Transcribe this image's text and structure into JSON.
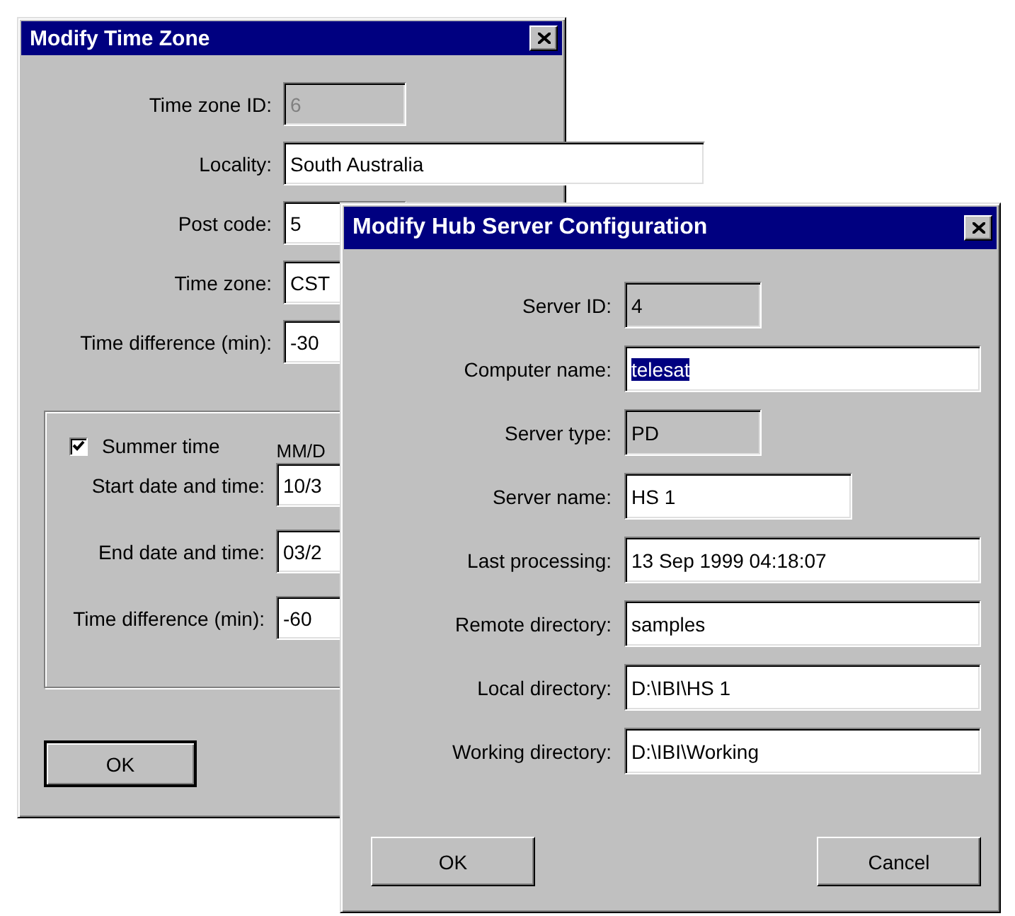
{
  "windows": [
    {
      "title": "Modify Time Zone",
      "fields": [
        {
          "label": "Time zone ID:",
          "value": "6",
          "disabled": true,
          "read_only": false,
          "highlighted": false
        },
        {
          "label": "Locality:",
          "value": "South Australia",
          "disabled": false,
          "read_only": false,
          "highlighted": false
        },
        {
          "label": "Post code:",
          "value": "5",
          "disabled": false,
          "read_only": false,
          "highlighted": false
        },
        {
          "label": "Time zone:",
          "value": "CST",
          "disabled": false,
          "read_only": false,
          "highlighted": false
        },
        {
          "label": "Time difference (min):",
          "value": "-30",
          "disabled": false,
          "read_only": false,
          "highlighted": false
        }
      ],
      "group": {
        "checkbox": {
          "label": "Summer time",
          "checked": true
        },
        "column_header": "MM/D",
        "fields": [
          {
            "label": "Start date and time:",
            "value": "10/3",
            "disabled": false,
            "read_only": false,
            "highlighted": false
          },
          {
            "label": "End date and time:",
            "value": "03/2",
            "disabled": false,
            "read_only": false,
            "highlighted": false
          },
          {
            "label": "Time difference (min):",
            "value": "-60",
            "disabled": false,
            "read_only": false,
            "highlighted": false
          }
        ]
      },
      "buttons": [
        "OK"
      ]
    },
    {
      "title": "Modify Hub Server Configuration",
      "fields": [
        {
          "label": "Server ID:",
          "value": "4",
          "disabled": false,
          "read_only": true,
          "highlighted": false
        },
        {
          "label": "Computer name:",
          "value": "telesat",
          "disabled": false,
          "read_only": false,
          "highlighted": true
        },
        {
          "label": "Server type:",
          "value": "PD",
          "disabled": false,
          "read_only": true,
          "highlighted": false
        },
        {
          "label": "Server name:",
          "value": "HS 1",
          "disabled": false,
          "read_only": false,
          "highlighted": false
        },
        {
          "label": "Last processing:",
          "value": "13 Sep 1999 04:18:07",
          "disabled": false,
          "read_only": false,
          "highlighted": false
        },
        {
          "label": "Remote directory:",
          "value": "samples",
          "disabled": false,
          "read_only": false,
          "highlighted": false
        },
        {
          "label": "Local directory:",
          "value": "D:\\IBI\\HS 1",
          "disabled": false,
          "read_only": false,
          "highlighted": false
        },
        {
          "label": "Working directory:",
          "value": "D:\\IBI\\Working",
          "disabled": false,
          "read_only": false,
          "highlighted": false
        }
      ],
      "buttons": [
        "OK",
        "Cancel"
      ]
    }
  ]
}
